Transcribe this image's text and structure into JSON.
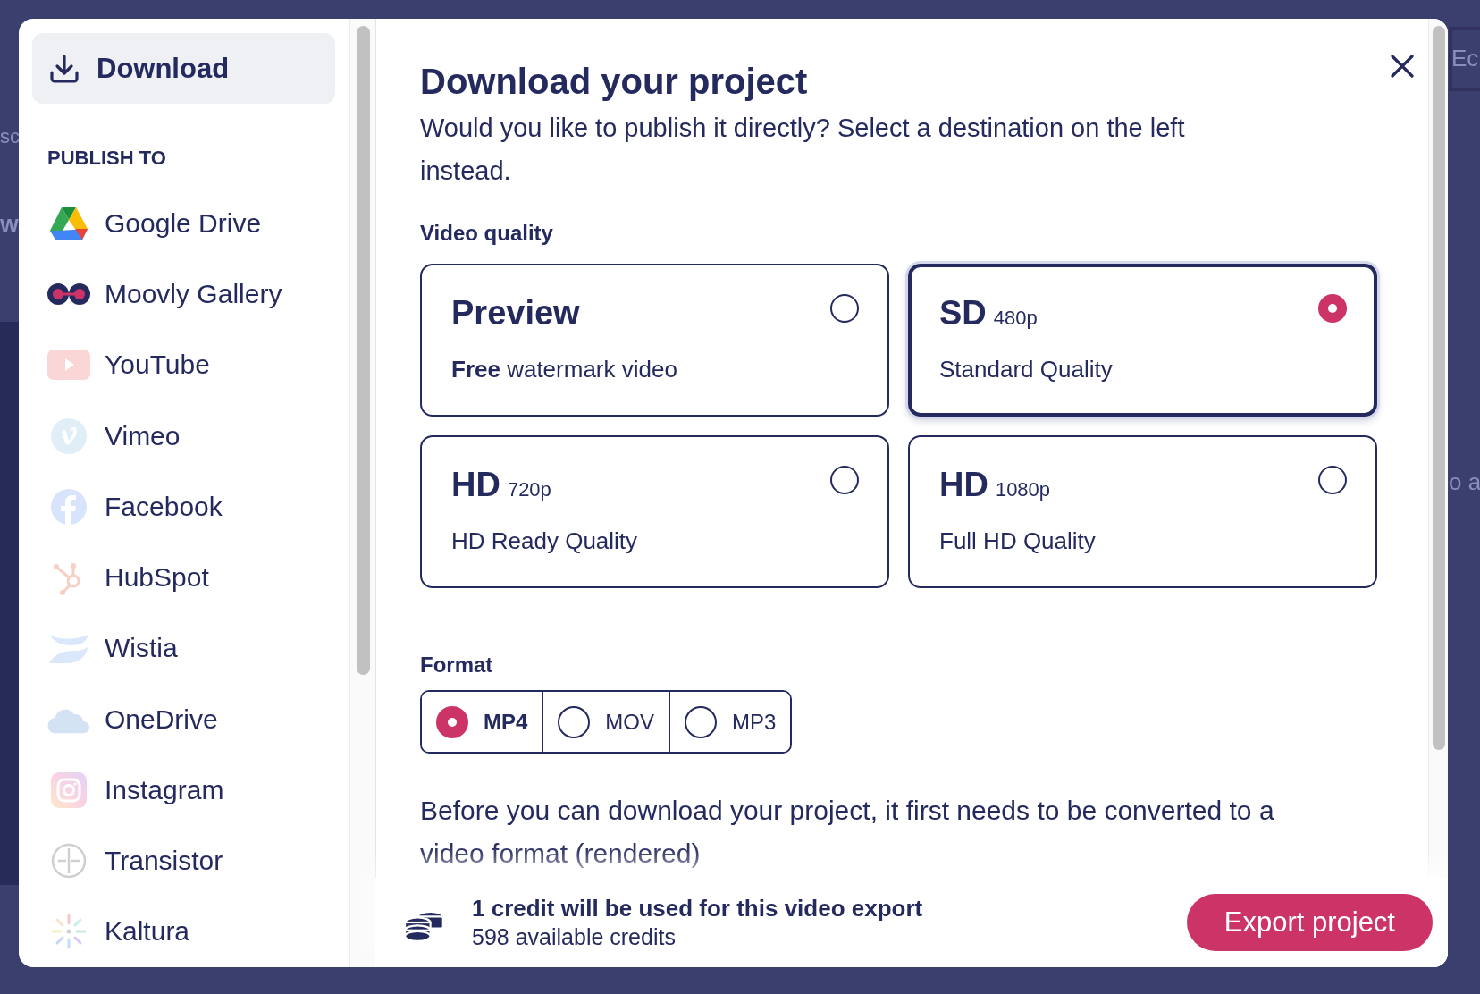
{
  "backdrop": {
    "fragments": [
      {
        "text": "Ec"
      },
      {
        "text": "sc"
      },
      {
        "text": "W"
      },
      {
        "text": "o a"
      }
    ]
  },
  "sidebar": {
    "download_button": {
      "label": "Download",
      "selected": true
    },
    "section_title": "PUBLISH TO",
    "items": [
      {
        "label": "Google Drive",
        "selected": false
      },
      {
        "label": "Moovly Gallery",
        "selected": false
      },
      {
        "label": "YouTube",
        "selected": false
      },
      {
        "label": "Vimeo",
        "selected": false
      },
      {
        "label": "Facebook",
        "selected": false
      },
      {
        "label": "HubSpot",
        "selected": false
      },
      {
        "label": "Wistia",
        "selected": false
      },
      {
        "label": "OneDrive",
        "selected": false
      },
      {
        "label": "Instagram",
        "selected": false
      },
      {
        "label": "Transistor",
        "selected": false
      },
      {
        "label": "Kaltura",
        "selected": false
      }
    ]
  },
  "main": {
    "title": "Download your project",
    "subtitle": "Would you like to publish it directly? Select a destination on the left instead.",
    "quality_label": "Video quality",
    "quality_options": [
      {
        "title": "Preview",
        "description": "**Free** watermark video",
        "selected": false
      },
      {
        "title": "SD",
        "resolution": "480p",
        "description": "Standard Quality",
        "selected": true
      },
      {
        "title": "HD",
        "resolution": "720p",
        "description": "HD Ready Quality",
        "selected": false
      },
      {
        "title": "HD",
        "resolution": "1080p",
        "description": "Full HD Quality",
        "selected": false
      }
    ],
    "format_label": "Format",
    "formats": [
      {
        "label": "MP4",
        "selected": true
      },
      {
        "label": "MOV",
        "selected": false
      },
      {
        "label": "MP3",
        "selected": false
      }
    ],
    "note": "Before you can download your project, it first needs to be converted to a video format (rendered)"
  },
  "footer": {
    "credit_text": "1 credit will be used for this video export",
    "available": "598 available credits",
    "export_button": "Export project"
  }
}
